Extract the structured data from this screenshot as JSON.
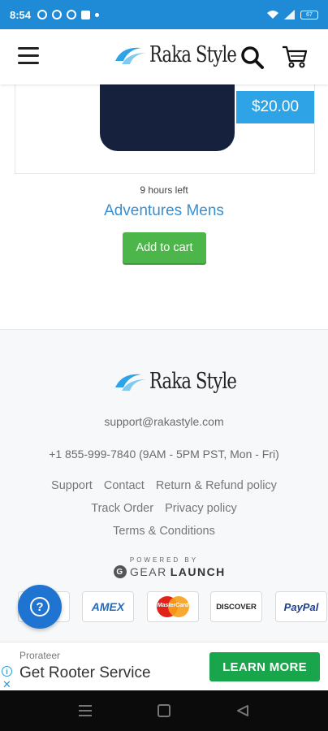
{
  "status_bar": {
    "time": "8:54",
    "battery": "67"
  },
  "header": {
    "brand": "Raka Style"
  },
  "product": {
    "price": "$20.00",
    "time_left": "9 hours left",
    "title": "Adventures Mens",
    "add_to_cart_label": "Add to cart"
  },
  "footer": {
    "brand": "Raka Style",
    "email": "support@rakastyle.com",
    "phone": "+1 855-999-7840 (9AM - 5PM PST, Mon - Fri)",
    "links_row1": [
      "Support",
      "Contact",
      "Return & Refund policy"
    ],
    "links_row2": [
      "Track Order",
      "Privacy policy"
    ],
    "links_row3": [
      "Terms & Conditions"
    ],
    "powered_by": "POWERED BY",
    "powered_brand_a": "GEAR",
    "powered_brand_b": "LAUNCH",
    "payments": [
      "AMEX",
      "MasterCard",
      "DISCOVER",
      "PayPal"
    ]
  },
  "ad": {
    "advertiser": "Prorateer",
    "headline": "Get Rooter Service",
    "cta": "LEARN MORE"
  },
  "colors": {
    "status_bar": "#1f8bd7",
    "price_badge": "#2ea3e6",
    "add_to_cart": "#4cb64a",
    "link_title": "#3a8fd0",
    "ad_cta": "#19a54b",
    "help_fab": "#1f74d2"
  }
}
